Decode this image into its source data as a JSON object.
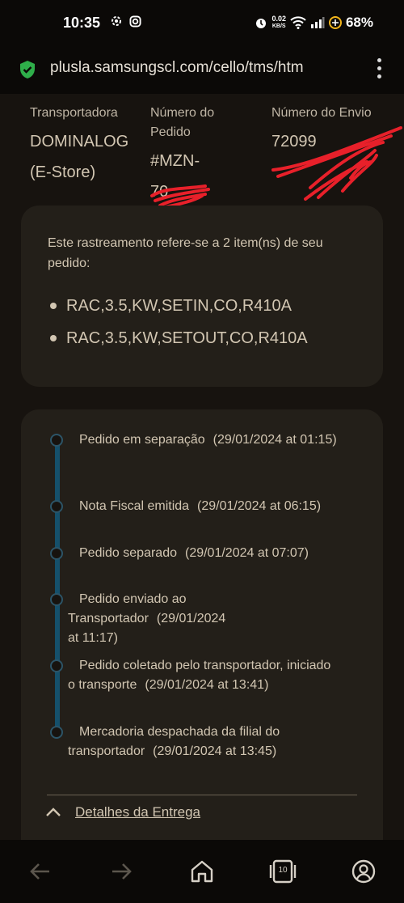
{
  "status_bar": {
    "time": "10:35",
    "net_speed_value": "0.02",
    "net_speed_unit": "KB/S",
    "battery": "68%"
  },
  "browser": {
    "url": "plusla.samsungscl.com/cello/tms/htm"
  },
  "shipment": {
    "carrier_label": "Transportadora",
    "carrier_value": "DOMINALOG (E-Store)",
    "order_label": "Número do Pedido",
    "order_value_line1": "#MZN-",
    "order_value_line2": "70",
    "shipment_label": "Número do Envio",
    "shipment_value": "72099"
  },
  "items": {
    "intro": "Este rastreamento refere-se a 2 item(ns) de seu pedido:",
    "list": [
      "RAC,3.5,KW,SETIN,CO,R410A",
      "RAC,3.5,KW,SETOUT,CO,R410A"
    ]
  },
  "timeline": {
    "events": [
      {
        "status": "Pedido em separação",
        "date": "(29/01/2024 at 01:15)"
      },
      {
        "status": "Nota Fiscal emitida",
        "date": "(29/01/2024 at 06:15)"
      },
      {
        "status": "Pedido separado",
        "date": "(29/01/2024 at 07:07)"
      },
      {
        "status": "Pedido enviado ao Transportador",
        "date": "(29/01/2024 at 11:17)"
      },
      {
        "status": "Pedido coletado pelo transportador, iniciado o transporte",
        "date": "(29/01/2024 at 13:41)"
      },
      {
        "status": "Mercadoria despachada da filial do transportador",
        "date": "(29/01/2024 at 13:45)"
      }
    ],
    "details_link": "Detalhes da Entrega"
  },
  "nav": {
    "tab_count": "10"
  },
  "colors": {
    "background": "#17130f",
    "card": "#231f19",
    "timeline_line": "#15506b",
    "text": "#d2c6b2",
    "redaction": "#e8202a",
    "secure_icon": "#2fae4a"
  },
  "icons": [
    "settings-icon",
    "instagram-icon",
    "alarm-icon",
    "wifi-icon",
    "signal-icon",
    "battery-icon",
    "secure-shield-icon",
    "more-vert-icon",
    "chevron-up-icon",
    "back-icon",
    "forward-icon",
    "home-icon",
    "tabs-icon",
    "profile-icon"
  ]
}
